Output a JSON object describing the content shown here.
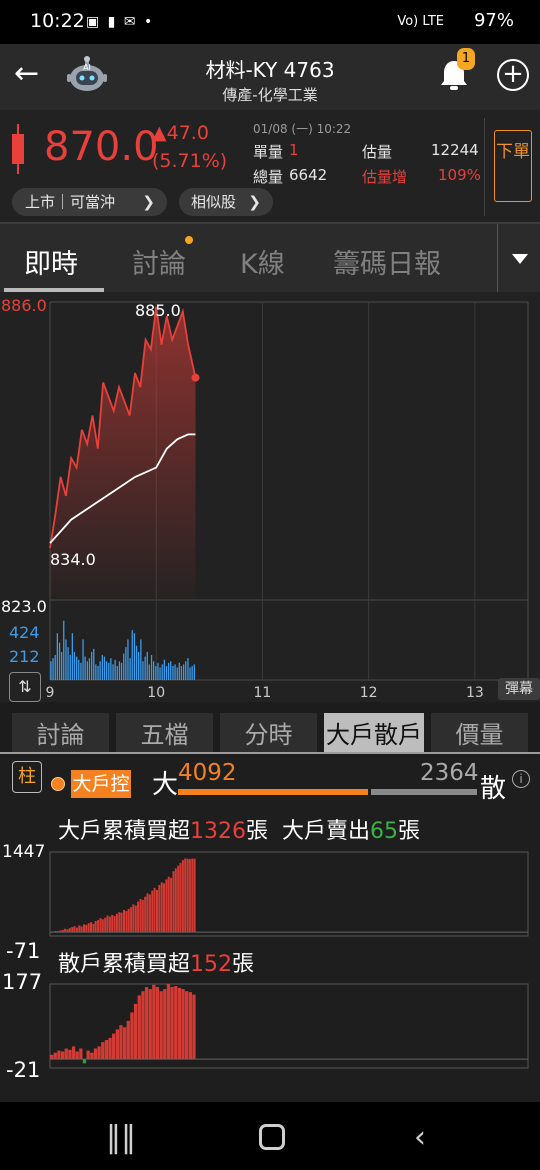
{
  "status_bar": {
    "time": "10:22",
    "notification_icons": "▣ ▮ ✉ •",
    "signal_text": "Vo) LTE",
    "battery": "97%"
  },
  "header": {
    "title": "材料-KY 4763",
    "subtitle": "傳產-化學工業",
    "ai_label": "AI",
    "notification_count": "1",
    "back_icon": "arrow-left-icon",
    "add_icon": "plus-circle-icon"
  },
  "quote": {
    "price": "870.0",
    "change": "▲47.0",
    "change_pct": "(5.71%)",
    "datetime": "01/08 (一) 10:22",
    "single_vol_label": "單量",
    "single_vol": "1",
    "est_vol_label": "估量",
    "est_vol": "12244",
    "total_vol_label": "總量",
    "total_vol": "6642",
    "est_inc_label": "估量增",
    "est_inc": "109%",
    "market_pill": "上市｜可當沖",
    "similar_pill": "相似股",
    "order_button": "下單",
    "colors": {
      "up": "#e8403a",
      "accent": "#f0902a"
    }
  },
  "tabs": [
    {
      "label": "即時",
      "active": true
    },
    {
      "label": "討論",
      "active": false,
      "has_dot": true
    },
    {
      "label": "K線",
      "active": false
    },
    {
      "label": "籌碼日報",
      "active": false
    }
  ],
  "chart_data": {
    "type": "line",
    "y_high_label": "886.0",
    "y_low_label": "823.0",
    "peak_label": "885.0",
    "low_label": "834.0",
    "vol_labels": [
      "424",
      "212"
    ],
    "x_ticks": [
      "9",
      "10",
      "11",
      "12",
      "13"
    ],
    "ylim": [
      823,
      886
    ],
    "series": [
      {
        "color": "#e8403a",
        "x": [
          9.0,
          9.05,
          9.1,
          9.15,
          9.2,
          9.25,
          9.3,
          9.35,
          9.4,
          9.45,
          9.5,
          9.55,
          9.6,
          9.65,
          9.7,
          9.75,
          9.8,
          9.85,
          9.9,
          9.95,
          10.0,
          10.05,
          10.1,
          10.15,
          10.2,
          10.25,
          10.3,
          10.35,
          10.37
        ],
        "values": [
          834,
          841,
          849,
          845,
          853,
          851,
          859,
          856,
          862,
          855,
          869,
          866,
          863,
          868,
          865,
          862,
          871,
          868,
          878,
          876,
          885,
          877,
          883,
          878,
          881,
          884,
          877,
          872,
          870
        ]
      },
      {
        "color": "#ffffff",
        "x": [
          9.0,
          9.2,
          9.4,
          9.6,
          9.8,
          10.0,
          10.1,
          10.2,
          10.3,
          10.37
        ],
        "values": [
          835,
          840,
          843,
          846,
          849,
          851,
          855,
          857,
          858,
          858
        ]
      }
    ],
    "volume_color": "#3d9be9",
    "volume": [
      120,
      140,
      160,
      300,
      240,
      180,
      380,
      260,
      210,
      160,
      300,
      180,
      150,
      130,
      110,
      260,
      150,
      120,
      140,
      180,
      200,
      100,
      90,
      120,
      160,
      150,
      120,
      110,
      140,
      100,
      130,
      90,
      120,
      110,
      170,
      210,
      260,
      140,
      320,
      300,
      220,
      180,
      260,
      120,
      150,
      180,
      100,
      160,
      120,
      90,
      110,
      80,
      100,
      130,
      90,
      110,
      120,
      90,
      100,
      80,
      110,
      90,
      100,
      120,
      140,
      80,
      90,
      100
    ],
    "volume_ylim": [
      0,
      500
    ]
  },
  "danmu_label": "彈幕",
  "subtabs": [
    {
      "label": "討論",
      "active": false
    },
    {
      "label": "五檔",
      "active": false
    },
    {
      "label": "分時",
      "active": false
    },
    {
      "label": "大戶散戶",
      "active": true
    },
    {
      "label": "價量",
      "active": false
    }
  ],
  "lower": {
    "zhu_label": "柱",
    "control_tag": "大戶控",
    "big_label": "大",
    "big_value": "4092",
    "small_value": "2364",
    "small_label": "散",
    "big_cum_prefix": "大戶累積買超",
    "big_cum_value": "1326",
    "big_cum_unit": "張",
    "big_sell_prefix": "大戶賣出",
    "big_sell_value": "65",
    "big_sell_unit": "張",
    "big_axis_top": "1447",
    "big_axis_bottom": "-71",
    "small_cum_prefix": "散戶累積買超",
    "small_cum_value": "152",
    "small_cum_unit": "張",
    "small_axis_top": "177",
    "small_axis_bottom": "-21",
    "big_bars": [
      5,
      8,
      20,
      15,
      30,
      40,
      60,
      50,
      70,
      90,
      110,
      80,
      120,
      100,
      140,
      130,
      160,
      180,
      150,
      200,
      220,
      250,
      230,
      260,
      300,
      280,
      310,
      290,
      330,
      360,
      350,
      400,
      380,
      420,
      450,
      500,
      480,
      550,
      600,
      580,
      640,
      700,
      680,
      750,
      800,
      760,
      850,
      900,
      880,
      950,
      1000,
      980,
      1100,
      1150,
      1200,
      1250,
      1300,
      1330,
      1326,
      1320,
      1330,
      1326
    ],
    "big_ylim": [
      -71,
      1447
    ],
    "small_bars": [
      10,
      15,
      20,
      18,
      25,
      22,
      30,
      18,
      25,
      -10,
      20,
      15,
      25,
      30,
      40,
      45,
      50,
      60,
      70,
      80,
      75,
      90,
      110,
      130,
      150,
      160,
      170,
      165,
      175,
      170,
      160,
      165,
      177,
      170,
      172,
      168,
      165,
      160,
      158,
      152
    ],
    "small_ylim": [
      -21,
      177
    ]
  },
  "navbar": {
    "recent_icon": "recent-apps-icon",
    "home_icon": "home-icon",
    "back_icon": "back-chevron-icon"
  }
}
